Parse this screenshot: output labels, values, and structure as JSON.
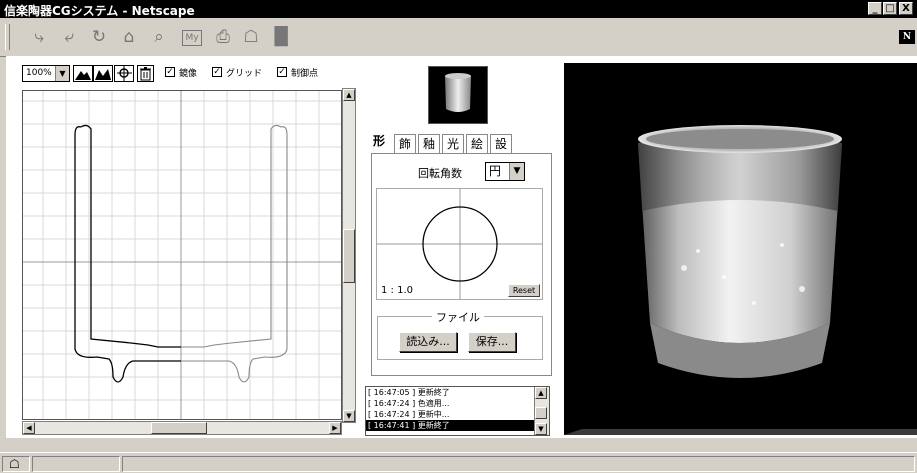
{
  "window": {
    "title": "信楽陶器CGシステム - Netscape",
    "title_icon": "app-icon",
    "controls": [
      "_",
      "□",
      "X"
    ]
  },
  "toolbar": {
    "icons": [
      "back-icon",
      "forward-icon",
      "reload-icon",
      "home-icon",
      "search-icon",
      "my-netscape-icon",
      "print-icon",
      "security-icon",
      "stop-icon"
    ],
    "mynetscape_label": "My",
    "logo": "N"
  },
  "editor": {
    "zoom": "100%",
    "checkboxes": [
      {
        "label": "鏡像",
        "checked": true
      },
      {
        "label": "グリッド",
        "checked": true
      },
      {
        "label": "制御点",
        "checked": true
      }
    ],
    "tools": [
      "mountain-icon",
      "mountain-filled-icon",
      "zoom-icon",
      "trash-icon"
    ]
  },
  "tabs": {
    "items": [
      "形",
      "飾",
      "釉",
      "光",
      "絵",
      "設"
    ],
    "active": 0
  },
  "shape_panel": {
    "rotation_label": "回転角数",
    "rotation_value": "円",
    "ratio": "1 : 1.0",
    "reset_label": "Reset",
    "file_group_label": "ファイル",
    "load_label": "読込み...",
    "save_label": "保存..."
  },
  "log": {
    "lines": [
      {
        "text": "[ 16:47:05 ] 更新終了",
        "selected": false
      },
      {
        "text": "[ 16:47:24 ] 色適用...",
        "selected": false
      },
      {
        "text": "[ 16:47:24 ] 更新中...",
        "selected": false
      },
      {
        "text": "[ 16:47:41 ] 更新終了",
        "selected": true
      }
    ]
  },
  "colors": {
    "titlebar_bg": "#000000",
    "chrome": "#d4d0c8",
    "render_bg": "#000000"
  }
}
